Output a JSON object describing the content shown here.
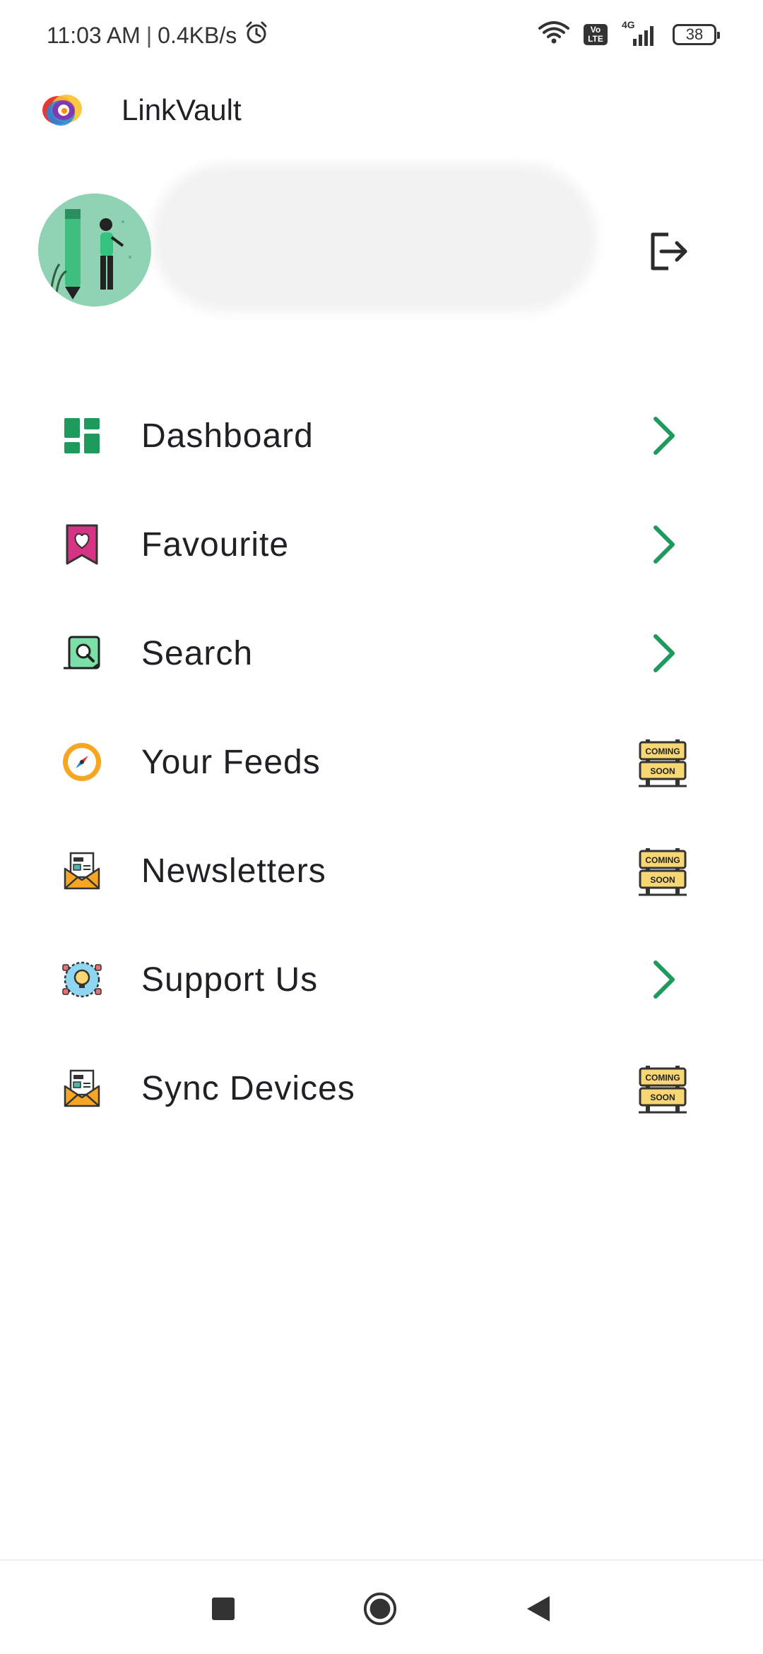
{
  "status_bar": {
    "time": "11:03 AM",
    "separator": "|",
    "speed": "0.4KB/s",
    "network": "4G",
    "volte_top": "Vo",
    "volte_bottom": "LTE",
    "battery": "38"
  },
  "app": {
    "title": "LinkVault"
  },
  "menu": {
    "items": [
      {
        "label": "Dashboard",
        "icon": "dashboard-icon",
        "trailing": "chevron"
      },
      {
        "label": "Favourite",
        "icon": "bookmark-heart-icon",
        "trailing": "chevron"
      },
      {
        "label": "Search",
        "icon": "search-document-icon",
        "trailing": "chevron"
      },
      {
        "label": "Your Feeds",
        "icon": "compass-icon",
        "trailing": "coming-soon"
      },
      {
        "label": "Newsletters",
        "icon": "news-envelope-icon",
        "trailing": "coming-soon"
      },
      {
        "label": "Support Us",
        "icon": "idea-support-icon",
        "trailing": "chevron"
      },
      {
        "label": "Sync Devices",
        "icon": "news-envelope-icon",
        "trailing": "coming-soon"
      }
    ]
  },
  "coming_soon": {
    "line1": "COMING",
    "line2": "SOON"
  },
  "colors": {
    "accent": "#1e9a5c",
    "text": "#202124"
  }
}
